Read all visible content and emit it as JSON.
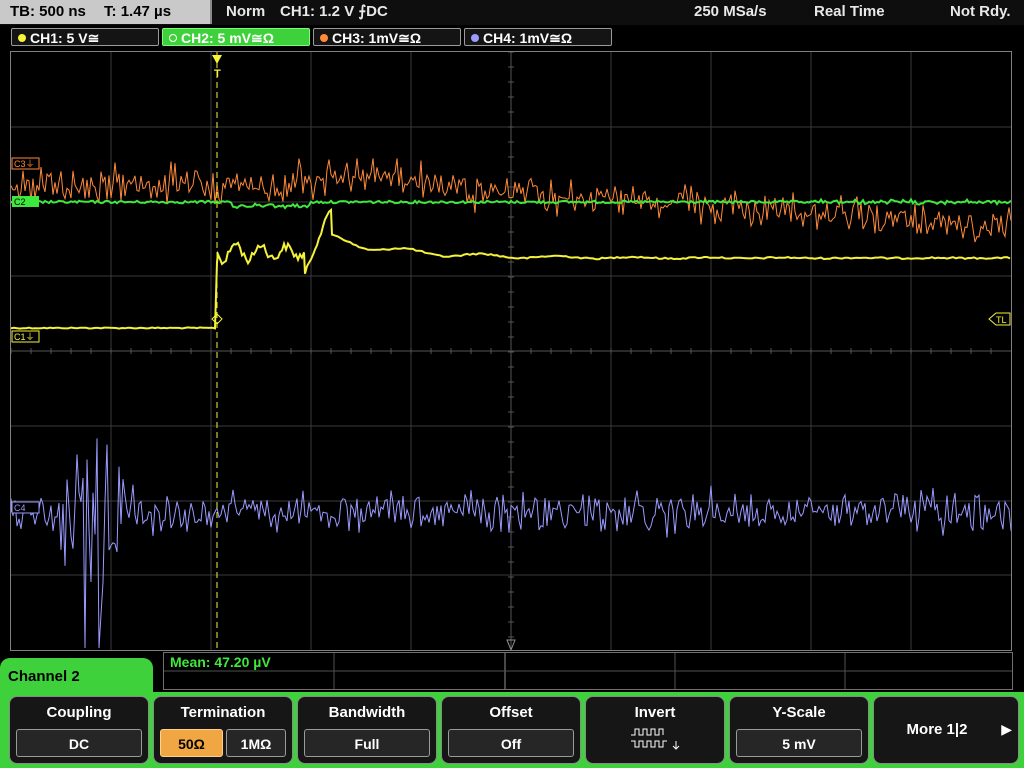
{
  "status": {
    "timebase": "TB: 500 ns",
    "trigger_time": "T: 1.47 µs",
    "mode": "Norm",
    "trigger_info": "CH1: 1.2 V ⨍DC",
    "sample_rate": "250 MSa/s",
    "acq_mode": "Real Time",
    "ready_state": "Not Rdy."
  },
  "channels": [
    {
      "label": "CH1: 5 V≅",
      "color": "#f5f23a",
      "active": false
    },
    {
      "label": "CH2: 5 mV≅Ω",
      "color": "#3fe83c",
      "active": true
    },
    {
      "label": "CH3: 1mV≅Ω",
      "color": "#ff8a3a",
      "active": false
    },
    {
      "label": "CH4: 1mV≅Ω",
      "color": "#9a9aff",
      "active": false
    }
  ],
  "markers": {
    "c3": "C3⏚",
    "c2": "C2",
    "c1": "C1⏚",
    "c4": "C4",
    "trigger_level": "TL",
    "trigger_pos": "T"
  },
  "measurement": {
    "text": "Mean: 47.20 µV"
  },
  "panel": {
    "title": "Channel 2"
  },
  "softkeys": {
    "coupling": {
      "label": "Coupling",
      "value": "DC"
    },
    "termination": {
      "label": "Termination",
      "value_a": "50Ω",
      "value_b": "1MΩ"
    },
    "bandwidth": {
      "label": "Bandwidth",
      "value": "Full"
    },
    "offset": {
      "label": "Offset",
      "value": "Off"
    },
    "invert": {
      "label": "Invert"
    },
    "yscale": {
      "label": "Y-Scale",
      "value": "5 mV"
    },
    "more": {
      "label": "More 1|2"
    }
  },
  "colors": {
    "ch1": "#f5f23a",
    "ch2": "#3fe83c",
    "ch3": "#ff8a3a",
    "ch4": "#9a9aff",
    "panel": "#3fd13c",
    "selected": "#f0a642"
  }
}
